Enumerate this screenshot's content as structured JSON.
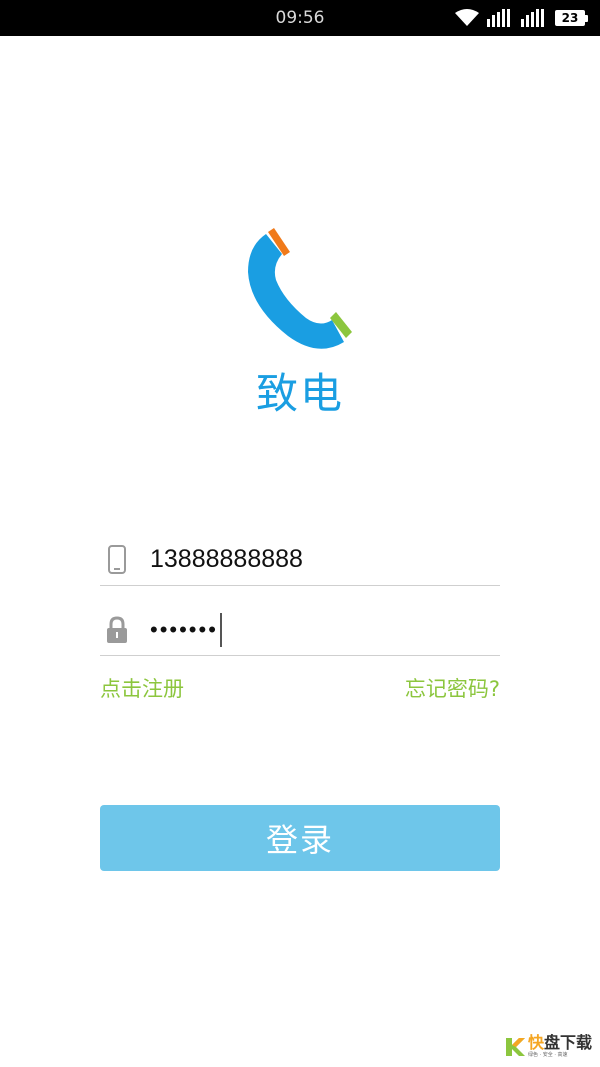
{
  "status_bar": {
    "time": "09:56",
    "battery": "23",
    "icons": [
      "wifi-icon",
      "signal-icon",
      "signal-icon",
      "battery-icon"
    ]
  },
  "app": {
    "name": "致电",
    "logo_icon": "phone-handset-logo",
    "colors": {
      "brand_blue": "#1a9ee2",
      "accent_orange": "#f07a1a",
      "accent_green": "#8cc63e",
      "button_blue": "#6ec6ea"
    }
  },
  "login_form": {
    "phone_value": "13888888888",
    "phone_icon": "mobile-phone-icon",
    "password_value": "•••••••",
    "password_icon": "lock-icon",
    "register_link": "点击注册",
    "forgot_link": "忘记密码?",
    "login_button": "登录"
  },
  "watermark": {
    "brand": "快盘下载",
    "brand_highlight": "快",
    "brand_rest": "盘下载",
    "slogan": "绿色 · 安全 · 高速"
  }
}
